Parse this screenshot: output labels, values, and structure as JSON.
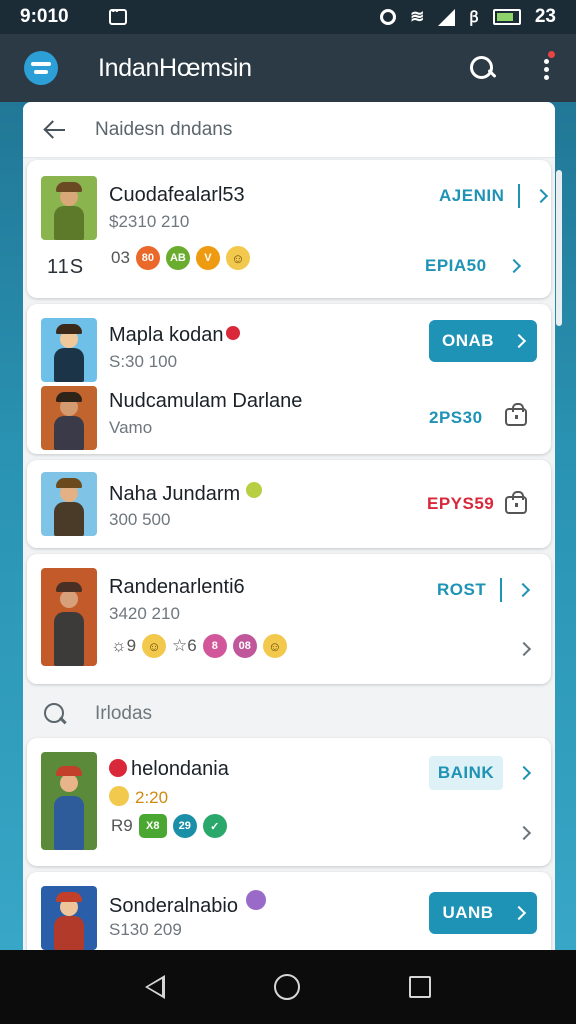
{
  "status_bar": {
    "time": "9:010",
    "battery_text": "23",
    "network_text": "ꞵ"
  },
  "app_bar": {
    "title": "IndanHœmsin",
    "icons": [
      "menu-logo-icon",
      "search-icon",
      "more-vert-icon"
    ]
  },
  "sheet": {
    "title": "Naidesn dndans"
  },
  "items": [
    {
      "name": "Cuodafealarl53",
      "sub": "$2310 210",
      "count": "11S",
      "badge_lead": "03",
      "badges": [
        {
          "text": "80",
          "color": "#e9682a"
        },
        {
          "text": "AB",
          "color": "#6aac2d"
        },
        {
          "text": "V",
          "color": "#ef9b12"
        },
        {
          "text": "☺",
          "color": "#f2c94c"
        }
      ],
      "action_top": "AJENIN",
      "action_bottom": "EPIA50",
      "thumb_colors": {
        "bg": "#8ab44e",
        "head": "#d8a878",
        "body": "#5c7a2a",
        "hat": "#6a4a22"
      }
    },
    {
      "name": "Mapla kodan",
      "sub": "S:30 100",
      "pill_label": "ONAB",
      "thumb_colors": {
        "bg": "#6ec0e8",
        "head": "#f0c89a",
        "body": "#1b3448",
        "hat": "#3b2a1a"
      }
    },
    {
      "name": "Nudcamulam Darlane",
      "sub": "Vamo",
      "action_label": "2PS30",
      "thumb_colors": {
        "bg": "#c2642e",
        "head": "#d49a70",
        "body": "#3a3a48",
        "hat": "#2d2318"
      }
    },
    {
      "name": "Naha Jundarm",
      "sub": "300 500",
      "action_label": "EPYS59",
      "thumb_colors": {
        "bg": "#7fc4e6",
        "head": "#e4b184",
        "body": "#4a3a28",
        "hat": "#6b4a1e"
      }
    },
    {
      "name": "Randenarlenti6",
      "sub": "3420 210",
      "badge_lead": "☼9",
      "badges": [
        {
          "text": "☺",
          "color": "#f2c94c"
        },
        {
          "text": "☆6",
          "color": "transparent"
        },
        {
          "text": "8",
          "color": "#d2579a"
        },
        {
          "text": "08",
          "color": "#c0579a"
        },
        {
          "text": "☺",
          "color": "#f2c94c"
        }
      ],
      "action_label": "ROST",
      "thumb_colors": {
        "bg": "#c25a2a",
        "head": "#d8a07a",
        "body": "#3d3a3a",
        "hat": "#4a3024"
      }
    }
  ],
  "section": {
    "label": "Irlodas"
  },
  "items2": [
    {
      "name": "helondania",
      "sub": "2:20",
      "badge_lead": "R9",
      "badges": [
        {
          "text": "X8",
          "color": "#4aa832"
        },
        {
          "text": "29",
          "color": "#1c8fa8"
        },
        {
          "text": "✓",
          "color": "#2aa86b"
        }
      ],
      "pill_label": "BAINK",
      "thumb_colors": {
        "bg": "#5a8a3a",
        "head": "#e8b48a",
        "body": "#2e5c9a",
        "hat": "#c2402a"
      }
    },
    {
      "name": "Sonderalnabio",
      "sub": "S130 209",
      "pill_label": "UANB",
      "thumb_colors": {
        "bg": "#2a5ea8",
        "head": "#f0c49a",
        "body": "#b23a2a",
        "hat": "#c2402a"
      }
    }
  ]
}
